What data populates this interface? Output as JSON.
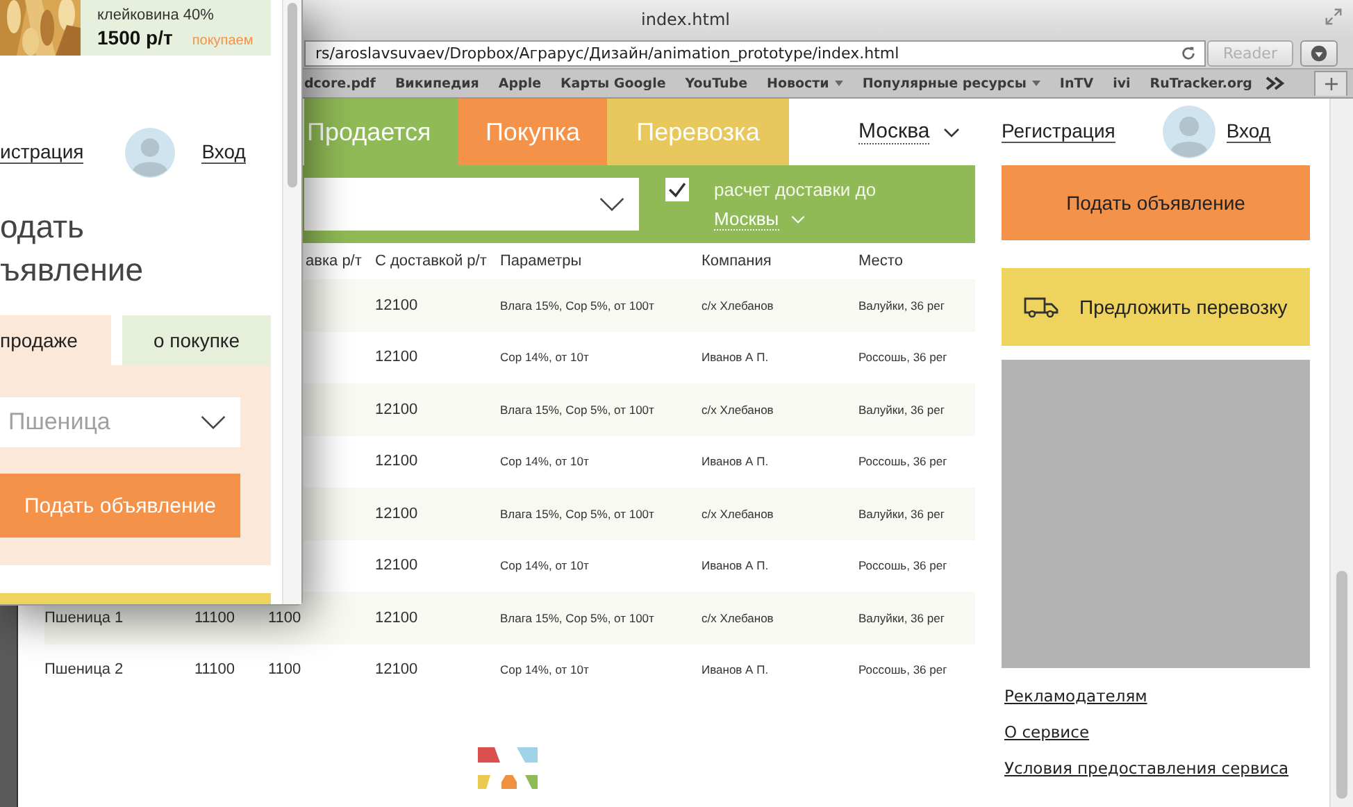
{
  "browser": {
    "title": "index.html",
    "address": "rs/aroslavsuvaev/Dropbox/Аграрус/Дизайн/animation_prototype/index.html",
    "reader": {
      "label": "Reader",
      "disabled": true
    },
    "bookmarks": [
      {
        "label": "dcore.pdf",
        "menu": false
      },
      {
        "label": "Википедия",
        "menu": false
      },
      {
        "label": "Apple",
        "menu": false
      },
      {
        "label": "Карты Google",
        "menu": false
      },
      {
        "label": "YouTube",
        "menu": false
      },
      {
        "label": "Новости",
        "menu": true
      },
      {
        "label": "Популярные ресурсы",
        "menu": true
      },
      {
        "label": "InTV",
        "menu": false
      },
      {
        "label": "ivi",
        "menu": false
      },
      {
        "label": "RuTracker.org",
        "menu": false
      }
    ]
  },
  "page": {
    "nav_tabs": [
      {
        "label": "Продается",
        "color": "#8fba55"
      },
      {
        "label": "Покупка",
        "color": "#f39248"
      },
      {
        "label": "Перевозка",
        "color": "#e8c85c"
      }
    ],
    "city": "Москва",
    "register": "Регистрация",
    "login": "Вход",
    "filter": {
      "delivery_checked": true,
      "delivery_label": "расчет доставки до",
      "delivery_city": "Москвы"
    },
    "table": {
      "header": {
        "delivery": "авка р/т",
        "with_delivery": "С доставкой р/т",
        "params": "Параметры",
        "company": "Компания",
        "place": "Место"
      },
      "rows": [
        {
          "with_delivery": "12100",
          "params": "Влага 15%, Сор 5%, от 100т",
          "company": "с/х Хлебанов",
          "place": "Валуйки, 36 рег"
        },
        {
          "with_delivery": "12100",
          "params": "Сор 14%, от 10т",
          "company": "Иванов А П.",
          "place": "Россошь, 36 рег"
        },
        {
          "with_delivery": "12100",
          "params": "Влага 15%, Сор 5%, от 100т",
          "company": "с/х Хлебанов",
          "place": "Валуйки, 36 рег"
        },
        {
          "with_delivery": "12100",
          "params": "Сор 14%, от 10т",
          "company": "Иванов А П.",
          "place": "Россошь, 36 рег"
        },
        {
          "with_delivery": "12100",
          "params": "Влага 15%, Сор 5%, от 100т",
          "company": "с/х Хлебанов",
          "place": "Валуйки, 36 рег"
        },
        {
          "with_delivery": "12100",
          "params": "Сор 14%, от 10т",
          "company": "Иванов А П.",
          "place": "Россошь, 36 рег"
        },
        {
          "name": "Пшеница 1",
          "price": "11100",
          "delivery": "1100",
          "with_delivery": "12100",
          "params": "Влага 15%, Сор 5%, от 100т",
          "company": "с/х Хлебанов",
          "place": "Валуйки, 36 рег"
        },
        {
          "name": "Пшеница 2",
          "price": "11100",
          "delivery": "1100",
          "with_delivery": "12100",
          "params": "Сор 14%, от 10т",
          "company": "Иванов А П.",
          "place": "Россошь, 36 рег"
        }
      ]
    },
    "side_buttons": [
      {
        "kind": "primary",
        "label": "Подать объявление"
      },
      {
        "kind": "transport",
        "label": "Предложить перевозку"
      }
    ],
    "footer_links": [
      "Рекламодателям",
      "О сервисе",
      "Условия предоставления сервиса"
    ]
  },
  "overlay": {
    "offer": {
      "text": "клейковина 40%",
      "price": "1500 р/т",
      "tag": "покупаем"
    },
    "register": "истрация",
    "login": "Вход",
    "heading_lines": [
      "одать",
      "ъявление"
    ],
    "tabs": [
      {
        "label": "продаже",
        "selected": true
      },
      {
        "label": "о покупке",
        "selected": false
      }
    ],
    "select": {
      "value": "Пшеница"
    },
    "submit": "Подать объявление"
  }
}
